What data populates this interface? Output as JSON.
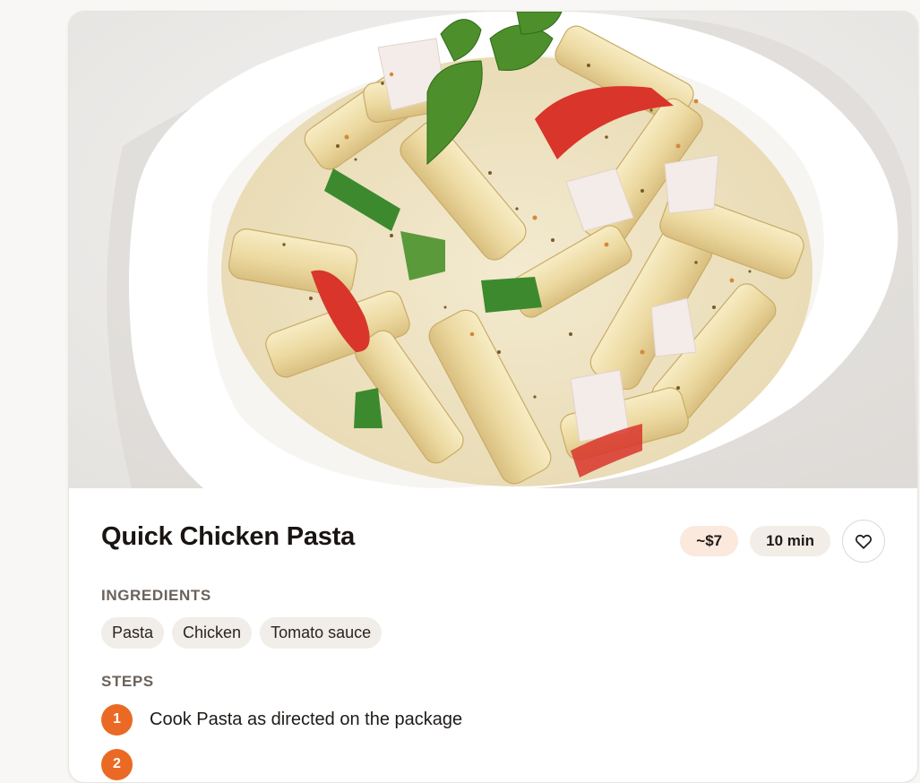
{
  "recipe": {
    "title": "Quick Chicken Pasta",
    "price": "~$7",
    "time": "10 min",
    "image_subject": "creamy penne pasta with bell peppers and mint in a white bowl"
  },
  "ingredients": {
    "label": "INGREDIENTS",
    "items": [
      "Pasta",
      "Chicken",
      "Tomato sauce"
    ]
  },
  "steps": {
    "label": "STEPS",
    "items": [
      {
        "number": "1",
        "text": "Cook Pasta as directed on the package"
      },
      {
        "number": "2",
        "text": ""
      }
    ]
  },
  "icons": {
    "favorite": "heart-outline-icon"
  },
  "colors": {
    "accent": "#ea6a25",
    "price_pill": "#fbe9de",
    "time_pill": "#f2ede6",
    "chip": "#f1ede8"
  }
}
